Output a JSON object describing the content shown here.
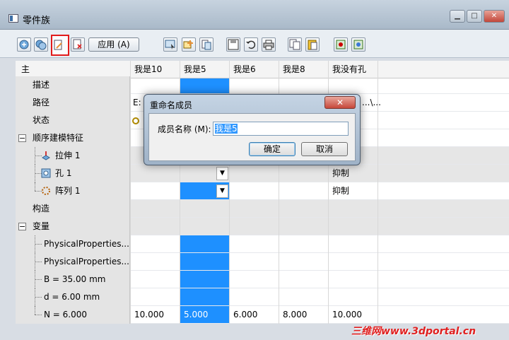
{
  "window": {
    "title": "零件族"
  },
  "toolbar": {
    "apply_label": "应用 (A)",
    "icons": [
      "insert-member-icon",
      "add-members-icon",
      "rename-member-icon",
      "delete-member-icon",
      "select-feature-icon",
      "add-feature-icon",
      "paste-icon",
      "save-icon",
      "undo-icon",
      "print-icon",
      "copy-icon",
      "paste-clipboard-icon",
      "verify-icon",
      "update-icon"
    ]
  },
  "table": {
    "header": {
      "main": "主",
      "columns": [
        "我是10",
        "我是5",
        "我是6",
        "我是8",
        "我没有孔"
      ]
    },
    "rows": {
      "desc": {
        "label": "描述"
      },
      "path": {
        "label": "路径",
        "col0": "E:",
        "col4": "...\\..."
      },
      "status": {
        "label": "状态"
      },
      "features": {
        "label": "顺序建模特征",
        "expander": "−"
      },
      "extrude": {
        "label": "拉伸 1"
      },
      "hole": {
        "label": "孔 1",
        "col4": "抑制"
      },
      "pattern": {
        "label": "阵列 1",
        "col4": "抑制"
      },
      "construct": {
        "label": "构造"
      },
      "variables": {
        "label": "变量",
        "expander": "−"
      },
      "phys1": {
        "label": "PhysicalProperties..."
      },
      "phys2": {
        "label": "PhysicalProperties..."
      },
      "b": {
        "label": "B = 35.00 mm"
      },
      "d": {
        "label": "d = 6.00 mm"
      },
      "n": {
        "label": "N = 6.000",
        "values": [
          "10.000",
          "5.000",
          "6.000",
          "8.000",
          "10.000"
        ]
      }
    },
    "selected_column_color": "#1e90ff"
  },
  "dialog": {
    "title": "重命名成员",
    "close": "✕",
    "field_label": "成员名称 (M):",
    "field_value": "我是5",
    "ok": "确定",
    "cancel": "取消"
  },
  "watermark": "三维网www.3dportal.cn"
}
